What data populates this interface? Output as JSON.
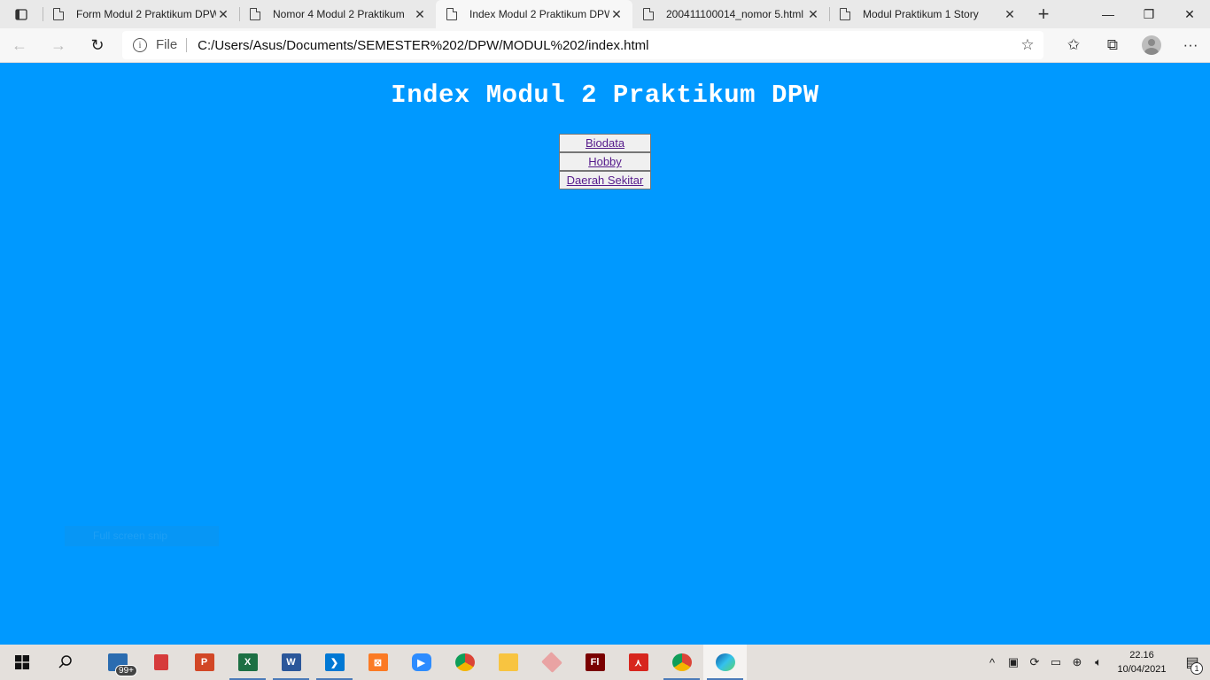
{
  "browser": {
    "tabs": [
      {
        "title": "Form Modul 2 Praktikum DPW",
        "active": false
      },
      {
        "title": "Nomor 4 Modul 2 Praktikum",
        "active": false
      },
      {
        "title": "Index Modul 2 Praktikum DPW",
        "active": true
      },
      {
        "title": "200411100014_nomor 5.html",
        "active": false
      },
      {
        "title": "Modul Praktikum 1 Story",
        "active": false
      }
    ],
    "address": {
      "scheme_label": "File",
      "url": "C:/Users/Asus/Documents/SEMESTER%202/DPW/MODUL%202/index.html"
    }
  },
  "page": {
    "heading": "Index Modul 2 Praktikum DPW",
    "links": [
      {
        "label": "Biodata"
      },
      {
        "label": "Hobby"
      },
      {
        "label": "Daerah Sekitar"
      }
    ],
    "ghost_text": "Full screen snip",
    "background_color": "#0099ff"
  },
  "taskbar": {
    "mail_badge": "99+",
    "clock_time": "22.16",
    "clock_date": "10/04/2021",
    "notification_count": "1"
  }
}
